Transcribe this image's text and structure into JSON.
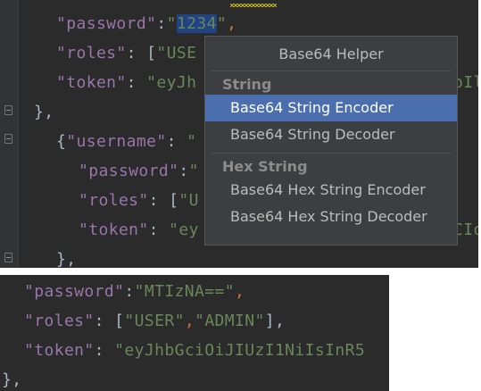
{
  "editor_top": {
    "lines": [
      {
        "key": "\"password\"",
        "sep": ":",
        "value_highlighted": "1234",
        "comma": ","
      },
      {
        "key": "\"roles\"",
        "sep": ": ",
        "open": "[",
        "value": "\"USE"
      },
      {
        "key": "\"token\"",
        "sep": ": ",
        "value": "\"eyJh",
        "tail": "oIl"
      },
      {
        "close": "},"
      },
      {
        "open": "{",
        "key": "\"username\"",
        "sep": ": ",
        "value": "\""
      },
      {
        "key": "\"password\"",
        "sep": ":",
        "value": "\""
      },
      {
        "key": "\"roles\"",
        "sep": ": ",
        "open": "[",
        "value": "\"U"
      },
      {
        "key": "\"token\"",
        "sep": ": ",
        "value": "\"ey",
        "tail": "CIo"
      },
      {
        "close": "},"
      }
    ]
  },
  "popup": {
    "title": "Base64 Helper",
    "groups": [
      {
        "label": "String",
        "items": [
          "Base64 String Encoder",
          "Base64 String Decoder"
        ]
      },
      {
        "label": "Hex String",
        "items": [
          "Base64 Hex String Encoder",
          "Base64 Hex String Decoder"
        ]
      }
    ],
    "selected": "Base64 String Encoder"
  },
  "editor_bottom": {
    "line1": {
      "key": "\"password\"",
      "sep": ":",
      "value": "\"MTIzNA==\"",
      "comma": ","
    },
    "line2": {
      "key": "\"roles\"",
      "sep": ": ",
      "open": "[",
      "v1": "\"USER\"",
      "comma": ",",
      "v2": "\"ADMIN\"",
      "close": "],"
    },
    "line3": {
      "key": "\"token\"",
      "sep": ": ",
      "value": "\"eyJhbGciOiJIUzI1NiIsInR5"
    },
    "line4": {
      "close": "},"
    }
  },
  "colors": {
    "editor_bg": "#2b2b2b",
    "key": "#9876aa",
    "string": "#6a8759",
    "selection": "#4b6eaf",
    "popup_bg": "#3c3f41"
  }
}
